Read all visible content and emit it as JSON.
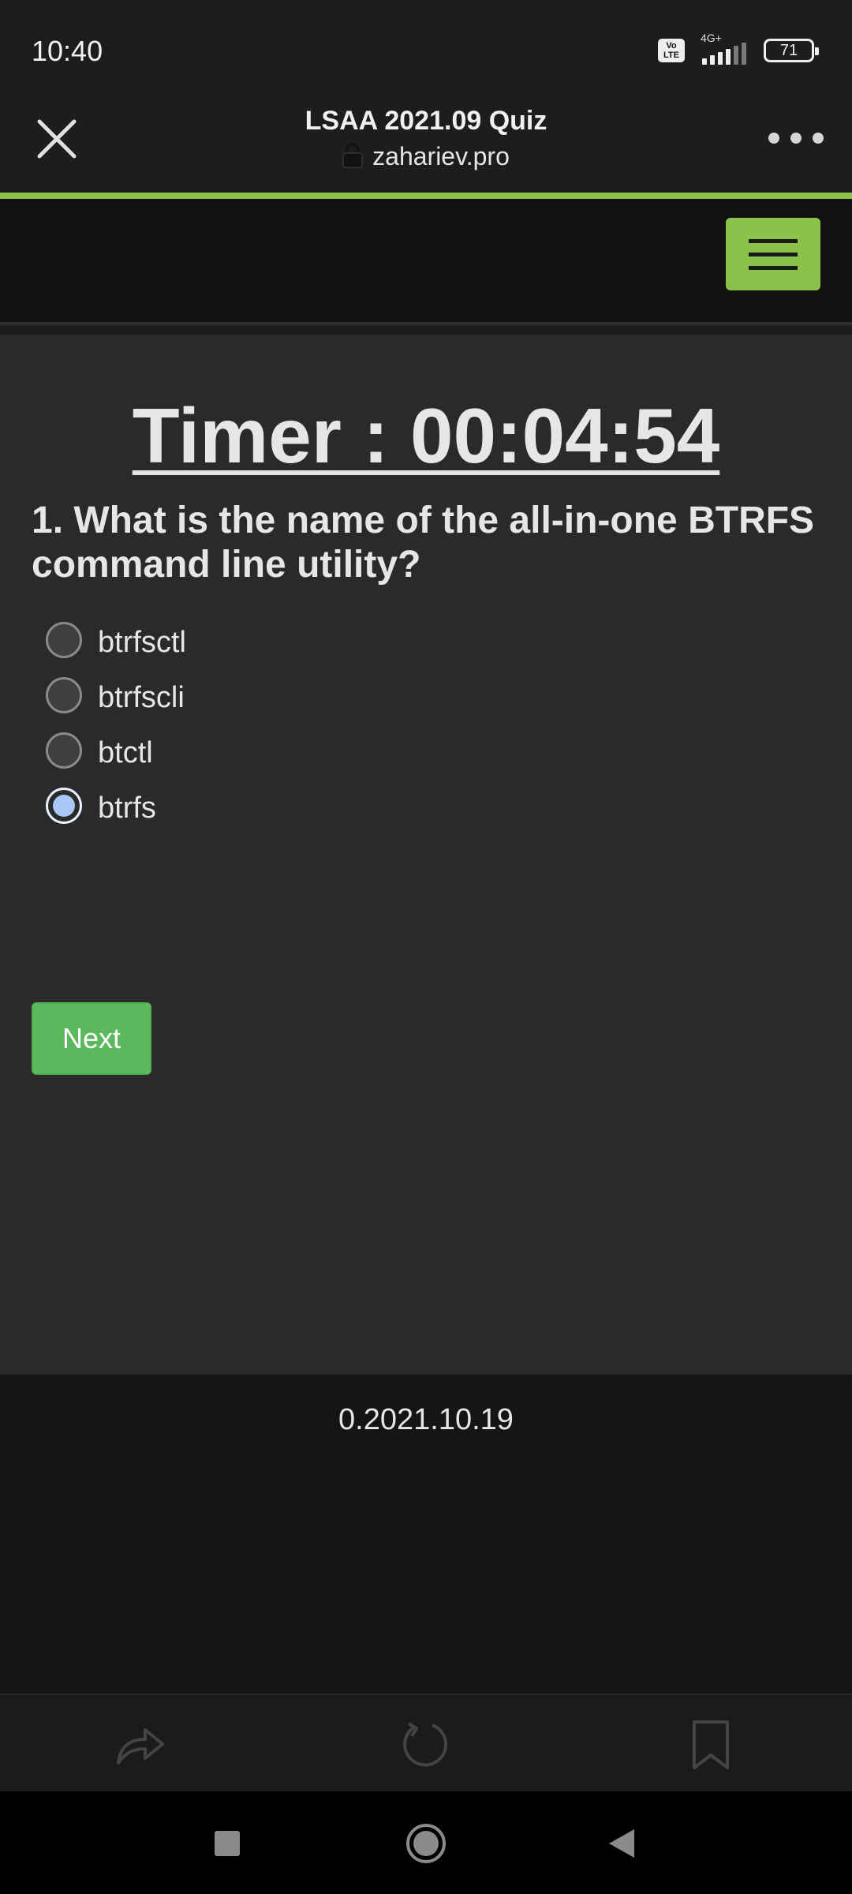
{
  "status_bar": {
    "time": "10:40",
    "volte": "Vo LTE",
    "network": "4G+",
    "battery": "71"
  },
  "browser": {
    "title": "LSAA 2021.09 Quiz",
    "url": "zahariev.pro",
    "accent_color": "#8bc34a"
  },
  "quiz": {
    "timer": "Timer : 00:04:54",
    "question": "1. What is the name of the all-in-one BTRFS command line utility?",
    "options": [
      {
        "label": "btrfsctl",
        "selected": false
      },
      {
        "label": "btrfscli",
        "selected": false
      },
      {
        "label": "btctl",
        "selected": false
      },
      {
        "label": "btrfs",
        "selected": true
      }
    ],
    "next_label": "Next"
  },
  "footer": {
    "version": "0.2021.10.19"
  },
  "icons": {
    "close": "close-icon",
    "lock": "lock-icon",
    "more": "more-icon",
    "menu": "hamburger-icon",
    "share": "share-icon",
    "reload": "reload-icon",
    "bookmark": "bookmark-icon",
    "recents": "recents-icon",
    "home": "home-icon",
    "back": "back-icon"
  }
}
